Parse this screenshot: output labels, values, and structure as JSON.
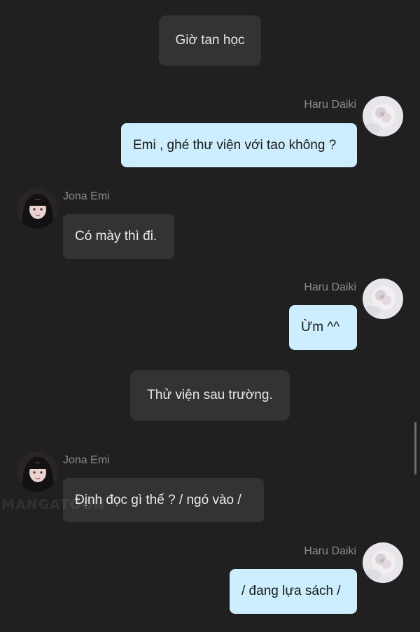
{
  "watermark": "MANGATOON",
  "messages": [
    {
      "type": "narration",
      "text": "Giờ tan học"
    },
    {
      "type": "outgoing",
      "sender": "Haru Daiki",
      "avatar": "haru-avatar",
      "text": "Emi , ghé thư viện với tao không ?"
    },
    {
      "type": "incoming",
      "sender": "Jona Emi",
      "avatar": "emi-avatar",
      "text": "Có mày thì đi."
    },
    {
      "type": "outgoing",
      "sender": "Haru Daiki",
      "avatar": "haru-avatar",
      "text": "Ừm ^^"
    },
    {
      "type": "narration",
      "text": "Thử viện sau trường."
    },
    {
      "type": "incoming",
      "sender": "Jona Emi",
      "avatar": "emi-avatar",
      "text": "Định đọc gì thế ? / ngó vào /"
    },
    {
      "type": "outgoing",
      "sender": "Haru Daiki",
      "avatar": "haru-avatar",
      "text": "/ đang lựa sách /"
    }
  ],
  "colors": {
    "background": "#202020",
    "outgoing_bubble": "#cdeeff",
    "incoming_bubble": "#333333",
    "narration_bubble": "#333333",
    "sender_name": "#8a8a8a"
  }
}
